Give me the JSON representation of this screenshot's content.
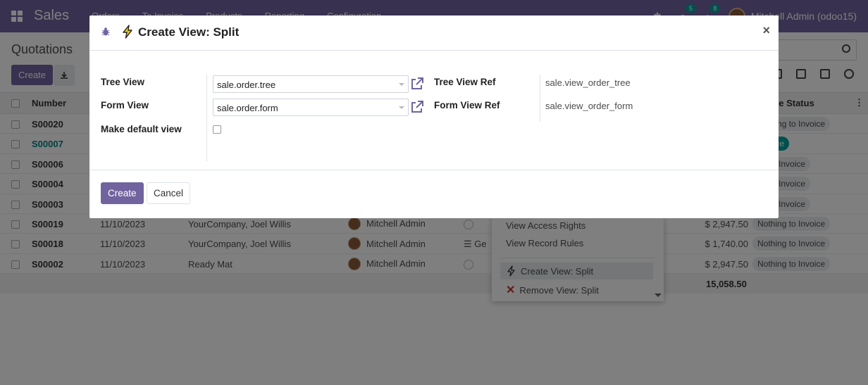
{
  "app": {
    "name": "Sales",
    "menu": [
      "Orders",
      "To Invoice",
      "Products",
      "Reporting",
      "Configuration"
    ],
    "systray": {
      "messages_count": "5",
      "activities_count": "8",
      "user": "Mitchell Admin (odoo15)"
    }
  },
  "control_panel": {
    "title": "Quotations",
    "create_label": "Create"
  },
  "list": {
    "headers": {
      "number": "Number",
      "status": "ce Status"
    },
    "rows": [
      {
        "number": "S00020",
        "date": "",
        "customer": "",
        "salesperson": "",
        "total": "",
        "status": "Nothing to Invoice"
      },
      {
        "number": "S00007",
        "date": "",
        "customer": "",
        "salesperson": "",
        "total": "",
        "status": "Invoice"
      },
      {
        "number": "S00006",
        "date": "",
        "customer": "",
        "salesperson": "",
        "total": "",
        "status": "ng to Invoice"
      },
      {
        "number": "S00004",
        "date": "",
        "customer": "",
        "salesperson": "",
        "total": "",
        "status": "ng to Invoice"
      },
      {
        "number": "S00003",
        "date": "",
        "customer": "",
        "salesperson": "",
        "total": "",
        "status": "ng to Invoice"
      },
      {
        "number": "S00019",
        "date": "11/10/2023",
        "customer": "YourCompany, Joel Willis",
        "salesperson": "Mitchell Admin",
        "total": "$ 2,947.50",
        "status": "Nothing to Invoice"
      },
      {
        "number": "S00018",
        "date": "11/10/2023",
        "customer": "YourCompany, Joel Willis",
        "salesperson": "Mitchell Admin",
        "total": "$ 1,740.00",
        "status": "Nothing to Invoice",
        "activity_text": "Ge"
      },
      {
        "number": "S00002",
        "date": "11/10/2023",
        "customer": "Ready Mat",
        "salesperson": "Mitchell Admin",
        "total": "$ 2,947.50",
        "status": "Nothing to Invoice"
      }
    ],
    "grand_total": "15,058.50"
  },
  "debug_menu": {
    "items": [
      "View Access Rights",
      "View Record Rules",
      "Create View: Split",
      "Remove View: Split"
    ]
  },
  "dialog": {
    "title": "Create View: Split",
    "fields": {
      "tree_view_label": "Tree View",
      "tree_view_value": "sale.order.tree",
      "form_view_label": "Form View",
      "form_view_value": "sale.order.form",
      "make_default_label": "Make default view",
      "tree_view_ref_label": "Tree View Ref",
      "tree_view_ref_value": "sale.view_order_tree",
      "form_view_ref_label": "Form View Ref",
      "form_view_ref_value": "sale.view_order_form"
    },
    "buttons": {
      "create": "Create",
      "cancel": "Cancel"
    },
    "close_glyph": "×"
  },
  "colors": {
    "brand": "#71639e",
    "teal": "#00a09d"
  },
  "icons": [
    "apps-icon",
    "bug-icon",
    "bolt-icon",
    "external-link-icon",
    "close-icon",
    "download-icon",
    "search-icon",
    "remove-icon"
  ]
}
